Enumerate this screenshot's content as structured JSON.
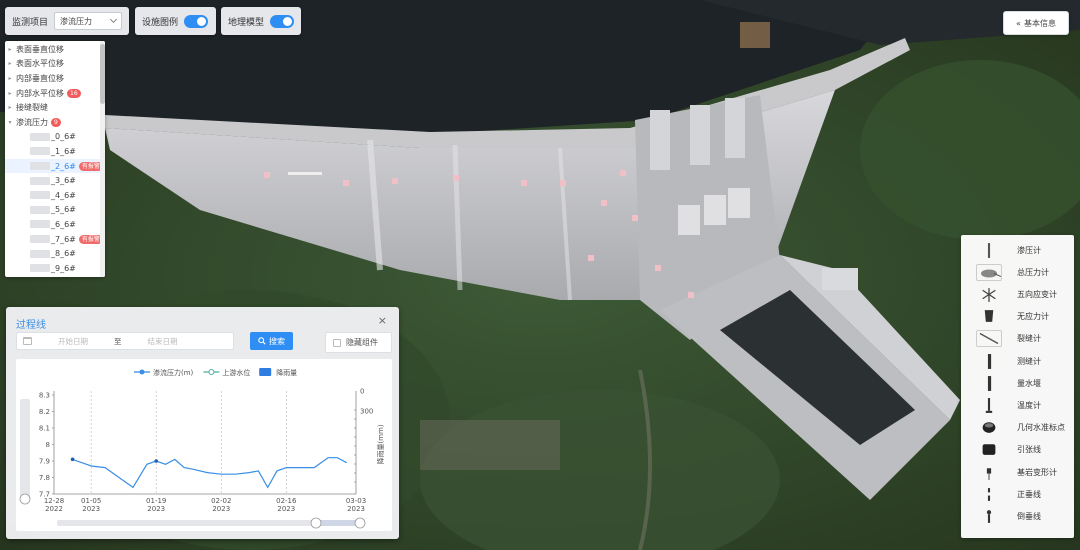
{
  "topbar": {
    "monitor_label": "监测项目",
    "monitor_value": "渗流压力",
    "facility_label": "设施图例",
    "terrain_label": "地理模型",
    "basic_info_label": "基本信息"
  },
  "tree": {
    "categories": [
      {
        "label": "表面垂直位移"
      },
      {
        "label": "表面水平位移"
      },
      {
        "label": "内部垂直位移"
      },
      {
        "label": "内部水平位移",
        "count": "16"
      },
      {
        "label": "接缝裂缝"
      },
      {
        "label": "渗流压力",
        "count": "9"
      }
    ],
    "children": [
      {
        "label": "_0_6#"
      },
      {
        "label": "_1_6#"
      },
      {
        "label": "_2_6#",
        "tag": "有报警"
      },
      {
        "label": "_3_6#"
      },
      {
        "label": "_4_6#"
      },
      {
        "label": "_5_6#"
      },
      {
        "label": "_6_6#"
      },
      {
        "label": "_7_6#",
        "tag": "有报警"
      },
      {
        "label": "_8_6#"
      },
      {
        "label": "_9_6#"
      }
    ]
  },
  "dialog": {
    "title": "过程线",
    "close": "×",
    "start_placeholder": "开始日期",
    "to_label": "至",
    "end_placeholder": "结束日期",
    "search_label": "搜索",
    "hide_label": "隐藏组件"
  },
  "chart_data": {
    "type": "line",
    "legend": [
      {
        "name": "渗流压力(m)",
        "color": "#3a8ee6",
        "style": "line-dot"
      },
      {
        "name": "上游水位",
        "color": "#4ab1a0",
        "style": "hollow-dot"
      },
      {
        "name": "降雨量",
        "color": "#2f7de1",
        "style": "bar"
      }
    ],
    "ylabel_left": "渗流压力(m)",
    "ylabel_right": "降雨量(mm)",
    "ylim_left": [
      7.7,
      8.3
    ],
    "yticks_left": [
      "8.3",
      "8.2",
      "8.1",
      "8",
      "7.9",
      "7.8",
      "7.7"
    ],
    "ylim_right": [
      0,
      300
    ],
    "yticks_right": [
      "0",
      "300"
    ],
    "xticks": [
      {
        "date": "12-28",
        "year": "2022"
      },
      {
        "date": "01-05",
        "year": "2023"
      },
      {
        "date": "01-19",
        "year": "2023"
      },
      {
        "date": "02-02",
        "year": "2023"
      },
      {
        "date": "02-16",
        "year": "2023"
      },
      {
        "date": "03-03",
        "year": "2023"
      }
    ],
    "series": [
      {
        "name": "渗流压力(m)",
        "x": [
          "2023-01-01",
          "2023-01-03",
          "2023-01-05",
          "2023-01-08",
          "2023-01-11",
          "2023-01-14",
          "2023-01-17",
          "2023-01-19",
          "2023-01-21",
          "2023-01-23",
          "2023-01-25",
          "2023-01-27",
          "2023-01-30",
          "2023-02-02",
          "2023-02-05",
          "2023-02-08",
          "2023-02-10",
          "2023-02-12",
          "2023-02-14",
          "2023-02-16",
          "2023-02-19",
          "2023-02-22",
          "2023-02-25",
          "2023-02-27",
          "2023-03-01"
        ],
        "values": [
          7.91,
          7.89,
          7.87,
          7.86,
          7.8,
          7.74,
          7.88,
          7.9,
          7.88,
          7.91,
          7.86,
          7.85,
          7.83,
          7.82,
          7.82,
          7.83,
          7.84,
          7.74,
          7.84,
          7.86,
          7.86,
          7.86,
          7.92,
          7.92,
          7.89
        ]
      }
    ]
  },
  "legend_panel": {
    "items": [
      {
        "label": "渗压计",
        "icon": "piezometer-icon"
      },
      {
        "label": "总压力计",
        "icon": "total-pressure-icon"
      },
      {
        "label": "五向应变计",
        "icon": "strain-rosette-icon"
      },
      {
        "label": "无应力计",
        "icon": "no-stress-meter-icon"
      },
      {
        "label": "裂缝计",
        "icon": "crack-meter-icon"
      },
      {
        "label": "测缝计",
        "icon": "joint-meter-icon"
      },
      {
        "label": "量水堰",
        "icon": "weir-icon"
      },
      {
        "label": "温度计",
        "icon": "thermometer-icon"
      },
      {
        "label": "几何水准标点",
        "icon": "leveling-point-icon"
      },
      {
        "label": "引张线",
        "icon": "tension-wire-icon"
      },
      {
        "label": "基岩变形计",
        "icon": "bedrock-extensometer-icon"
      },
      {
        "label": "正垂线",
        "icon": "plumb-line-icon"
      },
      {
        "label": "倒垂线",
        "icon": "inverted-plumb-icon"
      }
    ]
  }
}
